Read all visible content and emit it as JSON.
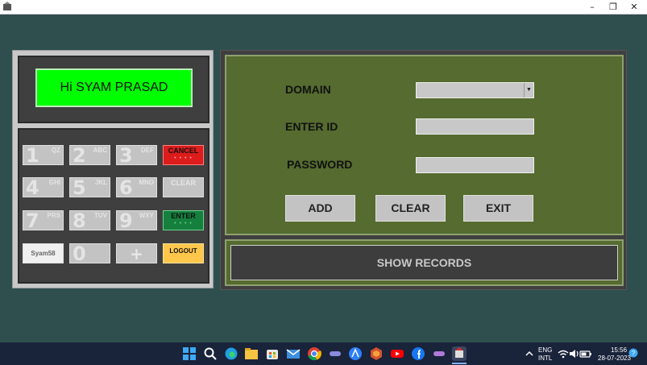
{
  "window": {
    "minimize_glyph": "–",
    "maximize_glyph": "❐",
    "close_glyph": "✕"
  },
  "display": {
    "greeting": "Hi SYAM PRASAD"
  },
  "keypad": {
    "keys": [
      {
        "num": "1",
        "letters": "QZ"
      },
      {
        "num": "2",
        "letters": "ABC"
      },
      {
        "num": "3",
        "letters": "DEF"
      },
      {
        "num": "4",
        "letters": "GHI"
      },
      {
        "num": "5",
        "letters": "JKL"
      },
      {
        "num": "6",
        "letters": "MNO"
      },
      {
        "num": "7",
        "letters": "PRS"
      },
      {
        "num": "8",
        "letters": "TUV"
      },
      {
        "num": "9",
        "letters": "WXY"
      },
      {
        "num": "0",
        "letters": ""
      }
    ],
    "cancel_label": "CANCEL",
    "clear_label": "CLEAR",
    "enter_label": "ENTER",
    "user_label": "Syam58",
    "plus_label": "+",
    "logout_label": "LOGOUT",
    "key_dots": "• • • •"
  },
  "form": {
    "domain_label": "DOMAIN",
    "domain_value": "",
    "enter_id_label": "ENTER ID",
    "enter_id_value": "",
    "password_label": "PASSWORD",
    "password_value": "",
    "add_label": "ADD",
    "clear_label": "CLEAR",
    "exit_label": "EXIT",
    "show_records_label": "SHOW RECORDS"
  },
  "taskbar": {
    "lang_top": "ENG",
    "lang_bottom": "INTL",
    "time": "15:56",
    "date": "28-07-2023"
  },
  "colors": {
    "background": "#2f4f4f",
    "display_green": "#00ff00",
    "form_olive": "#556b2f",
    "cancel_red": "#dd1c1c",
    "enter_green": "#15803d",
    "logout_yellow": "#ffc74a"
  }
}
